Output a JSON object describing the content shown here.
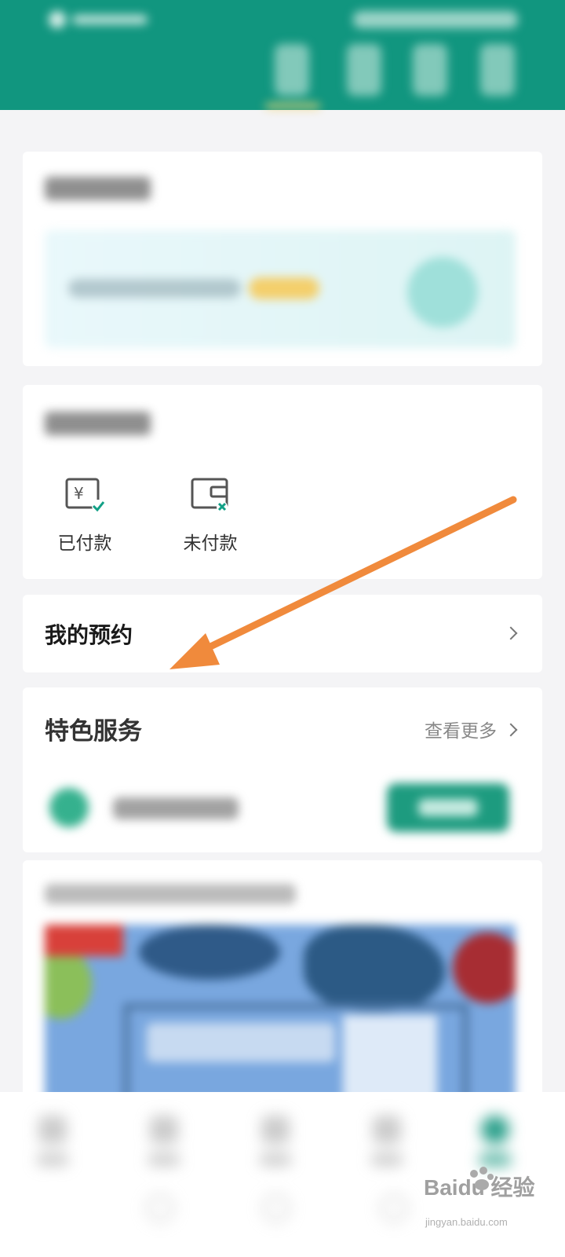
{
  "orders": {
    "paid_label": "已付款",
    "unpaid_label": "未付款"
  },
  "appointment": {
    "title": "我的预约"
  },
  "special_services": {
    "title": "特色服务",
    "more_label": "查看更多"
  },
  "watermark": {
    "main": "Baidu 经验",
    "sub": "jingyan.baidu.com"
  },
  "icons": {
    "paid": "yuan-receipt-check-icon",
    "unpaid": "wallet-x-icon",
    "chevron": "chevron-right-icon",
    "annotation": "orange-arrow"
  },
  "colors": {
    "header": "#11967f",
    "accent": "#13957d",
    "annotation_arrow": "#f08a3c"
  }
}
